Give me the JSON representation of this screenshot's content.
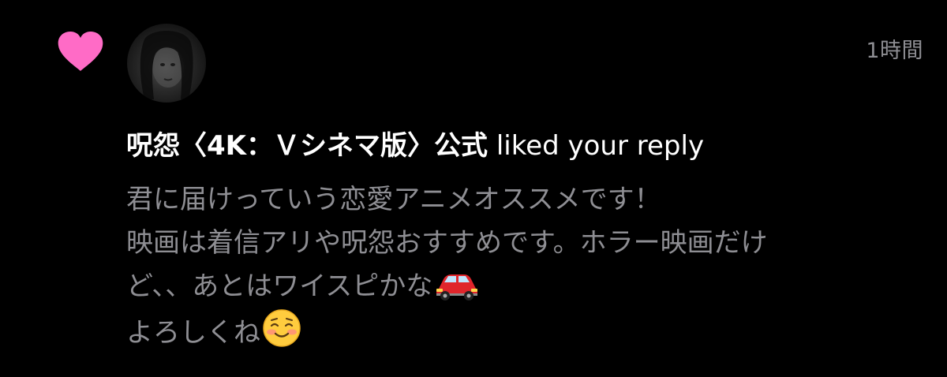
{
  "notification": {
    "timestamp": "1時間",
    "sender_name": "呪怨〈4K：Ｖシネマ版〉公式",
    "action_text": "liked your reply",
    "reply_lines": [
      "君に届けっていう恋愛アニメオススメです！",
      "映画は着信アリや呪怨おすすめです。ホラー映画だけ",
      "ど、、あとはワイスピかな",
      "よろしくね"
    ],
    "line3_emoji": "red-car-emoji",
    "line4_emoji": "smiling-blushing-emoji",
    "like_icon": "heart-icon",
    "heart_color": "#ff6bc6",
    "text_secondary_color": "#8e8e93"
  }
}
